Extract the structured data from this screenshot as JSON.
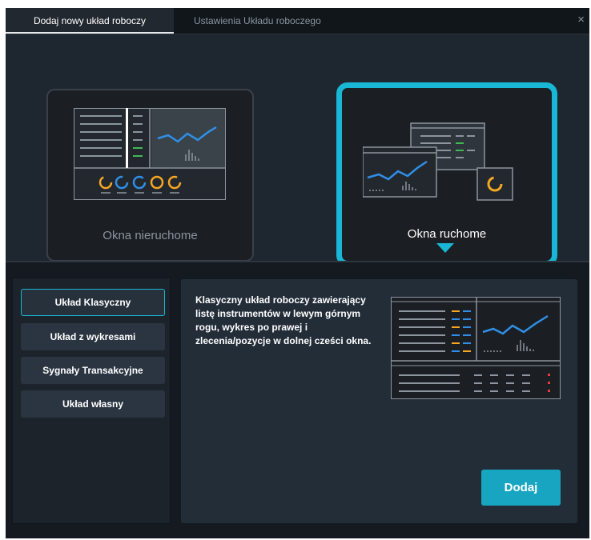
{
  "tabs": [
    {
      "label": "Dodaj nowy układ roboczy",
      "active": true
    },
    {
      "label": "Ustawienia Układu roboczego",
      "active": false
    }
  ],
  "close_symbol": "×",
  "window_modes": {
    "static_label": "Okna nieruchome",
    "moving_label": "Okna ruchome",
    "selected": "moving"
  },
  "layouts": [
    {
      "label": "Układ Klasyczny",
      "active": true
    },
    {
      "label": "Układ z wykresami",
      "active": false
    },
    {
      "label": "Sygnały Transakcyjne",
      "active": false
    },
    {
      "label": "Układ własny",
      "active": false
    }
  ],
  "description": "Klasyczny układ roboczy zawierający listę instrumentów w lewym górnym rogu, wykres po prawej i zlecenia/pozycje w dolnej cześci okna.",
  "add_button_label": "Dodaj",
  "colors": {
    "accent": "#1ab6d5",
    "button": "#18a5c2",
    "chart_line": "#2f8fe6",
    "orange": "#f5a623",
    "green": "#3fb950",
    "red": "#e03c3c"
  },
  "icons": [
    "close-icon",
    "static-windows-preview-icon",
    "floating-windows-preview-icon",
    "classic-layout-preview-icon"
  ]
}
